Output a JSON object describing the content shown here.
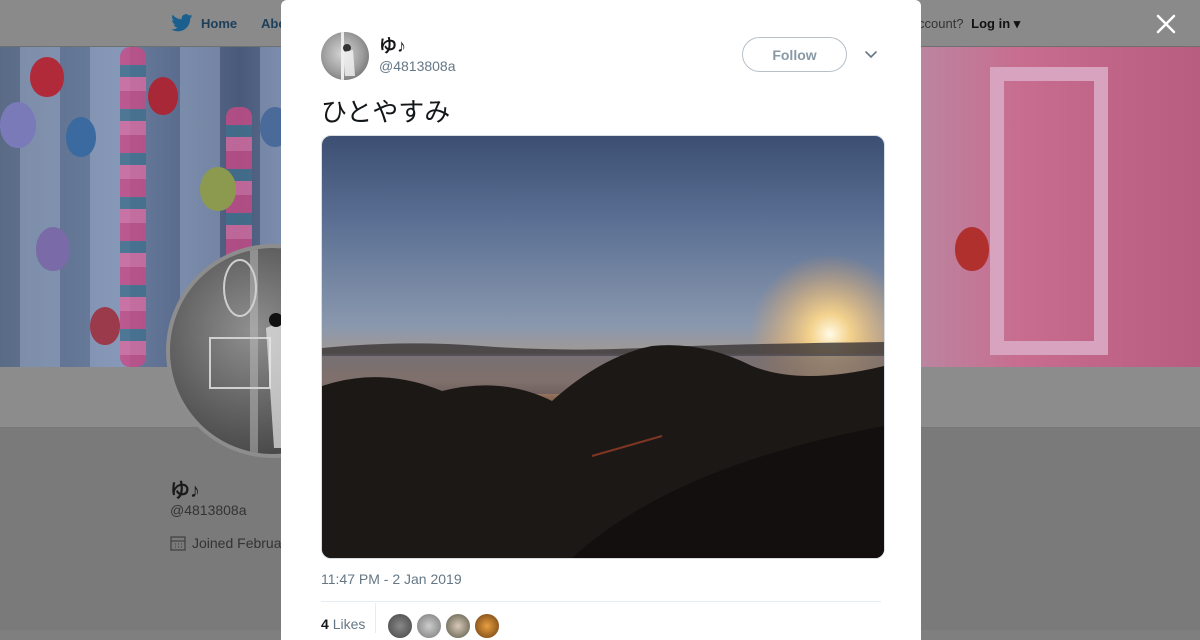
{
  "nav": {
    "home_label": "Home",
    "about_label": "Abo",
    "account_prompt": "ccount?",
    "login_label": "Log in"
  },
  "profile": {
    "name": "ゆ♪",
    "handle": "@4813808a",
    "joined_text": "Joined Februa"
  },
  "tweet": {
    "author_name": "ゆ♪",
    "author_handle": "@4813808a",
    "follow_label": "Follow",
    "text": "ひとやすみ",
    "timestamp": "11:47 PM - 2 Jan 2019",
    "likes_count": "4",
    "likes_label": "Likes"
  },
  "colors": {
    "twitter_blue": "#1da1f2",
    "overlay": "#7f7f7f",
    "text_secondary": "#657786"
  },
  "icons": {
    "bird": "twitter-bird-icon",
    "close": "close-icon",
    "chevron": "chevron-down-icon",
    "calendar": "calendar-icon"
  }
}
